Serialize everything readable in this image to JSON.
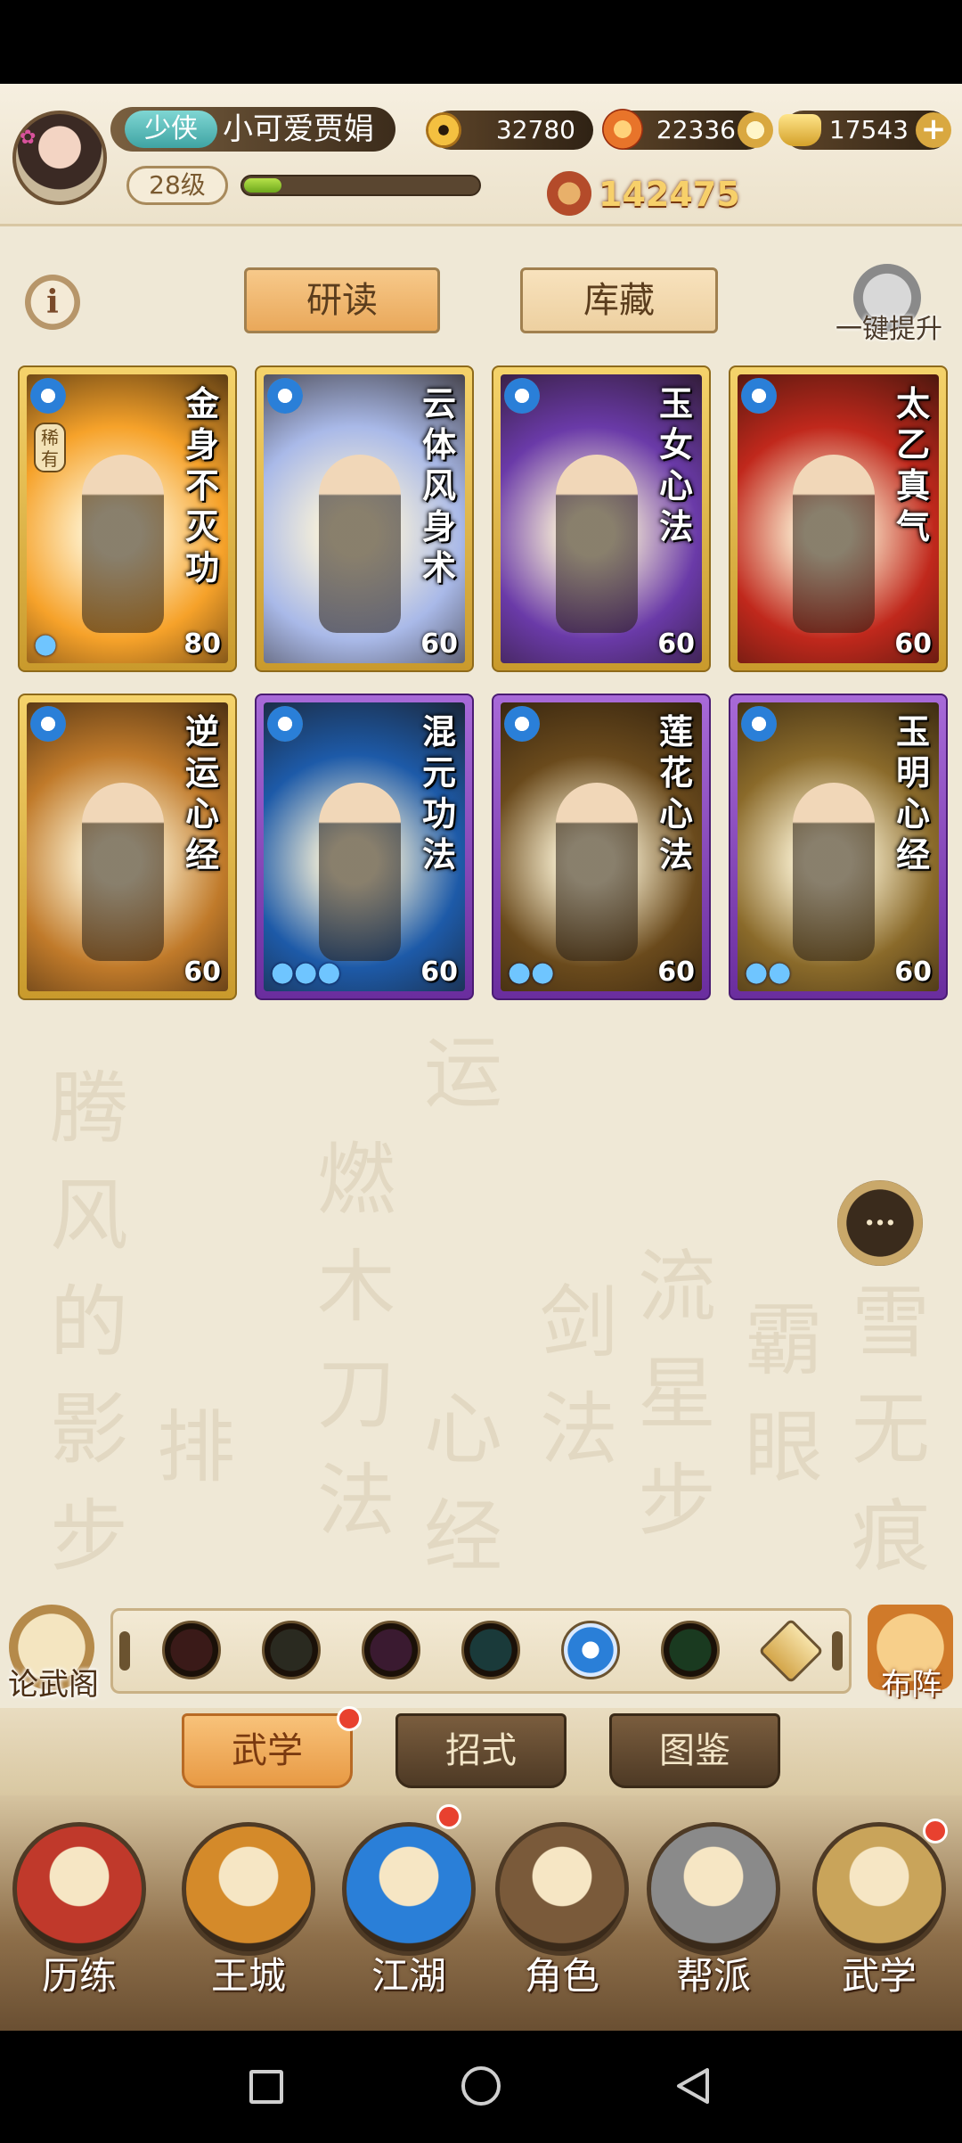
{
  "header": {
    "title_badge": "少侠",
    "player_name": "小可爱贾娟",
    "level": "28级",
    "xp_progress": 0.16,
    "copper": "32780",
    "flame": "22336",
    "gold": "17543",
    "power": "142475"
  },
  "tabs": {
    "study": "研读",
    "vault": "库藏",
    "one_click": "一键提升",
    "info": "i"
  },
  "cards": [
    {
      "title": "金身不灭功",
      "level": "80",
      "rarity": "稀有",
      "drops": "1",
      "frame": "gold",
      "bg": "#f6a22a"
    },
    {
      "title": "云体风身术",
      "level": "60",
      "drops": "",
      "frame": "gold",
      "bg": "#a9b9e8"
    },
    {
      "title": "玉女心法",
      "level": "60",
      "drops": "",
      "frame": "gold",
      "bg": "#6a3aa8"
    },
    {
      "title": "太乙真气",
      "level": "60",
      "drops": "",
      "frame": "gold",
      "bg": "#c0281c"
    },
    {
      "title": "逆运心经",
      "level": "60",
      "drops": "",
      "frame": "gold",
      "bg": "#c07a2a"
    },
    {
      "title": "混元功法",
      "level": "60",
      "drops": "3",
      "frame": "purple",
      "bg": "#1d5aa8"
    },
    {
      "title": "莲花心法",
      "level": "60",
      "drops": "2",
      "frame": "purple",
      "bg": "#6a4a1c"
    },
    {
      "title": "玉明心经",
      "level": "60",
      "drops": "2",
      "frame": "purple",
      "bg": "#8a6a2a"
    }
  ],
  "tray": {
    "left_label": "论武阁",
    "right_label": "布阵",
    "icons": [
      "sword-icon",
      "blade-icon",
      "fist-icon",
      "fan-icon",
      "spiral-icon",
      "dragon-icon",
      "arrow-up-icon"
    ]
  },
  "subtabs": {
    "wuxue": "武学",
    "zhaoshi": "招式",
    "tujian": "图鉴"
  },
  "nav": [
    "历练",
    "王城",
    "江湖",
    "角色",
    "帮派",
    "武学"
  ],
  "chat": "···",
  "background_glyphs": [
    "腾",
    "风",
    "的",
    "影",
    "步",
    "排",
    "燃",
    "木",
    "刀",
    "法",
    "运",
    "心",
    "经",
    "剑",
    "法",
    "流",
    "星",
    "步",
    "霸",
    "眼",
    "雪",
    "无",
    "痕"
  ]
}
